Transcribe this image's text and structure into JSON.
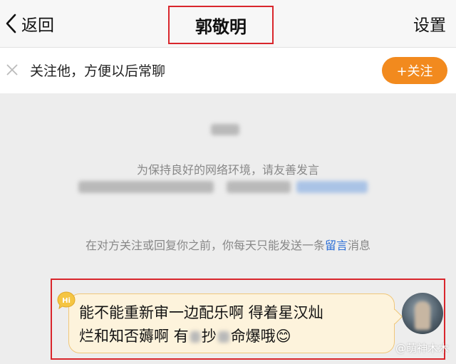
{
  "nav": {
    "back_label": "返回",
    "title": "郭敬明",
    "settings_label": "设置"
  },
  "follow_bar": {
    "tip": "关注他，方便以后常聊",
    "button_label": "+关注"
  },
  "notices": {
    "friendly": "为保持良好的网络环境，请友善发言",
    "limit_prefix": "在对方关注或回复你之前，你每天只能发送一条",
    "limit_link": "留言",
    "limit_suffix": "消息"
  },
  "message": {
    "badge": "Hi",
    "line1": "能不能重新审一边配乐啊 得着星汉灿",
    "line2": "烂和知否薅啊 有",
    "line2_b": "抄",
    "line2_c": "命爆哦",
    "emoji": "😊"
  },
  "watermark": "@萌神木木",
  "colors": {
    "accent": "#f28a1e",
    "highlight_border": "#d9262c",
    "link": "#2c6fd6",
    "bubble_bg": "#fdf3dc"
  }
}
